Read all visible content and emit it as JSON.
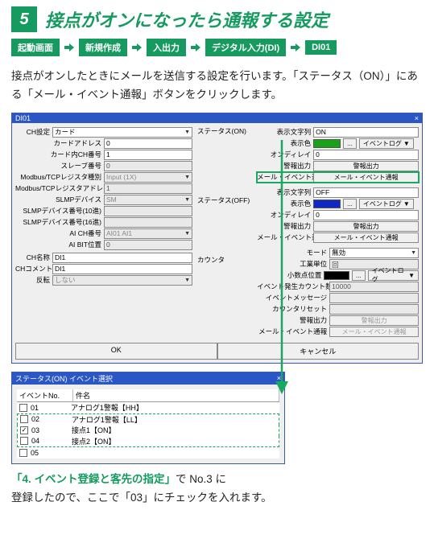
{
  "step_number": "5",
  "step_title": "接点がオンになったら通報する設定",
  "breadcrumbs": [
    "起動画面",
    "新規作成",
    "入出力",
    "デジタル入力(DI)",
    "DI01"
  ],
  "lead": "接点がオンしたときにメールを送信する設定を行います。「ステータス（ON）」にある「メール・イベント通報」ボタンをクリックします。",
  "win1": {
    "title": "DI01",
    "close": "×",
    "left": {
      "group1_label": "CH設定",
      "group1_val": "カード",
      "rows": [
        {
          "l": "カードアドレス",
          "v": "0"
        },
        {
          "l": "カード内CH番号",
          "v": "1"
        },
        {
          "l": "スレーブ番号",
          "v": "0"
        },
        {
          "l": "Modbus/TCPレジスタ種別",
          "v": "Input (1X)"
        },
        {
          "l": "Modbus/TCPレジスタアドレス",
          "v": "1"
        },
        {
          "l": "SLMPデバイス",
          "v": "SM"
        },
        {
          "l": "SLMPデバイス番号(10進)",
          "v": ""
        },
        {
          "l": "SLMPデバイス番号(16進)",
          "v": ""
        },
        {
          "l": "AI CH番号",
          "v": "AI01 AI1"
        },
        {
          "l": "AI BIT位置",
          "v": "0"
        }
      ],
      "ch_name_l": "CH名称",
      "ch_name_v": "DI1",
      "ch_cmt_l": "CHコメント",
      "ch_cmt_v": "DI1",
      "inv_l": "反転",
      "inv_v": "しない"
    },
    "mid": {
      "status_on": "ステータス(ON)",
      "status_off": "ステータス(OFF)",
      "counter": "カウンタ"
    },
    "right": {
      "on": {
        "disp_l": "表示文字列",
        "disp_v": "ON",
        "color_l": "表示色",
        "btn_dots": "...",
        "evlog": "イベントログ",
        "ondelay_l": "オンディレイ",
        "ondelay_v": "0",
        "alarm_out_l": "警報出力",
        "alarm_out_btn": "警報出力",
        "mail_l": "メール・イベント通報",
        "mail_btn": "メール・イベント通報"
      },
      "off": {
        "disp_l": "表示文字列",
        "disp_v": "OFF",
        "color_l": "表示色",
        "ondelay_l": "オンディレイ",
        "ondelay_v": "0",
        "alarm_out_l": "警報出力",
        "alarm_out_btn": "警報出力",
        "mail_l": "メール・イベント通報",
        "mail_btn": "メール・イベント通報"
      },
      "counter": {
        "mode_l": "モード",
        "mode_v": "無効",
        "unit_l": "工業単位",
        "unit_v": "回",
        "dec_l": "小数点位置",
        "cnt_l": "イベント発生カウント数",
        "cnt_v": "10000",
        "msg_l": "イベントメッセージ",
        "reset_l": "カウンタリセット",
        "alarm_out_l": "警報出力",
        "alarm_out_btn": "警報出力",
        "mail_l": "メール・イベント通報",
        "mail_btn": "メール・イベント通報"
      }
    },
    "ok": "OK",
    "cancel": "キャンセル"
  },
  "win2": {
    "title": "ステータス(ON) イベント選択",
    "col1": "イベントNo.",
    "col2": "件名",
    "rows": [
      {
        "no": "01",
        "name": "アナログ1警報【HH】",
        "checked": false
      },
      {
        "no": "02",
        "name": "アナログ1警報【LL】",
        "checked": false
      },
      {
        "no": "03",
        "name": "接点1【ON】",
        "checked": true
      },
      {
        "no": "04",
        "name": "接点2【ON】",
        "checked": false
      },
      {
        "no": "05",
        "name": "",
        "checked": false
      }
    ]
  },
  "footnote_strong": "「4. イベント登録と客先の指定」",
  "footnote_rest1": "で No.3 に",
  "footnote_rest2": "登録したので、ここで「03」にチェックを入れます。"
}
